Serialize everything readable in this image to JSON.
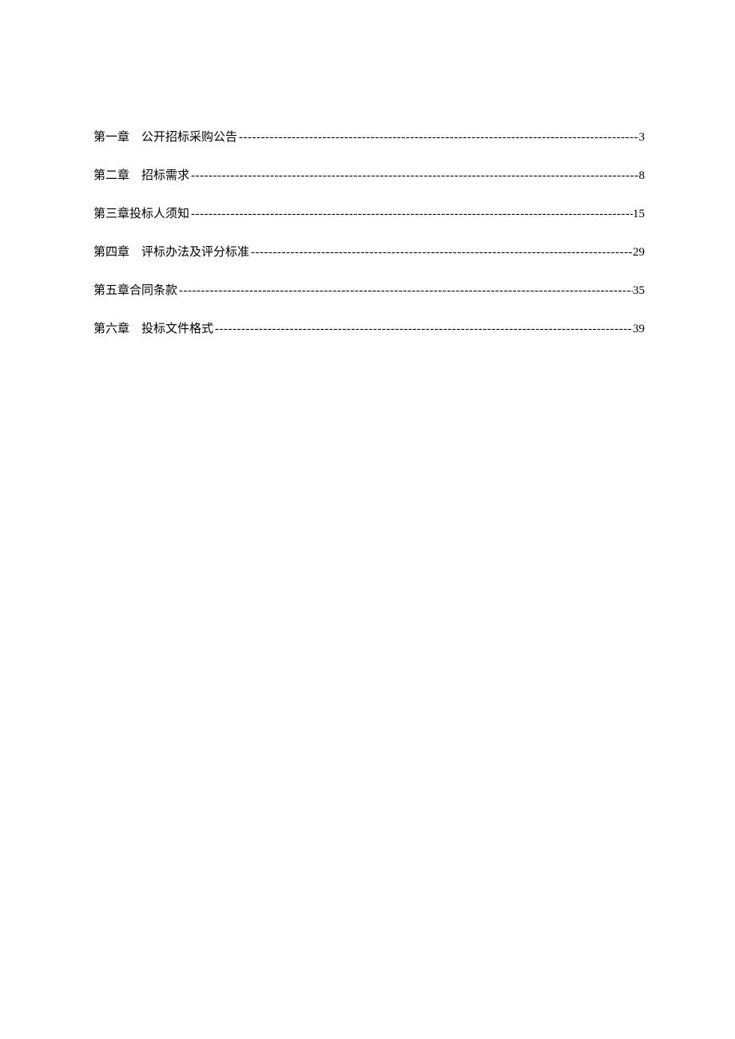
{
  "toc": {
    "entries": [
      {
        "chapter": "第一章",
        "title": "公开招标采购公告",
        "page": "3",
        "spaced": true
      },
      {
        "chapter": "第二章",
        "title": "招标需求",
        "page": "8",
        "spaced": true
      },
      {
        "chapter": "第三章",
        "title": "投标人须知",
        "page": "15",
        "spaced": false
      },
      {
        "chapter": "第四章",
        "title": "评标办法及评分标准",
        "page": "29",
        "spaced": true
      },
      {
        "chapter": "第五章",
        "title": "合同条款",
        "page": "35",
        "spaced": false
      },
      {
        "chapter": "第六章",
        "title": "投标文件格式",
        "page": "39",
        "spaced": true
      }
    ]
  }
}
